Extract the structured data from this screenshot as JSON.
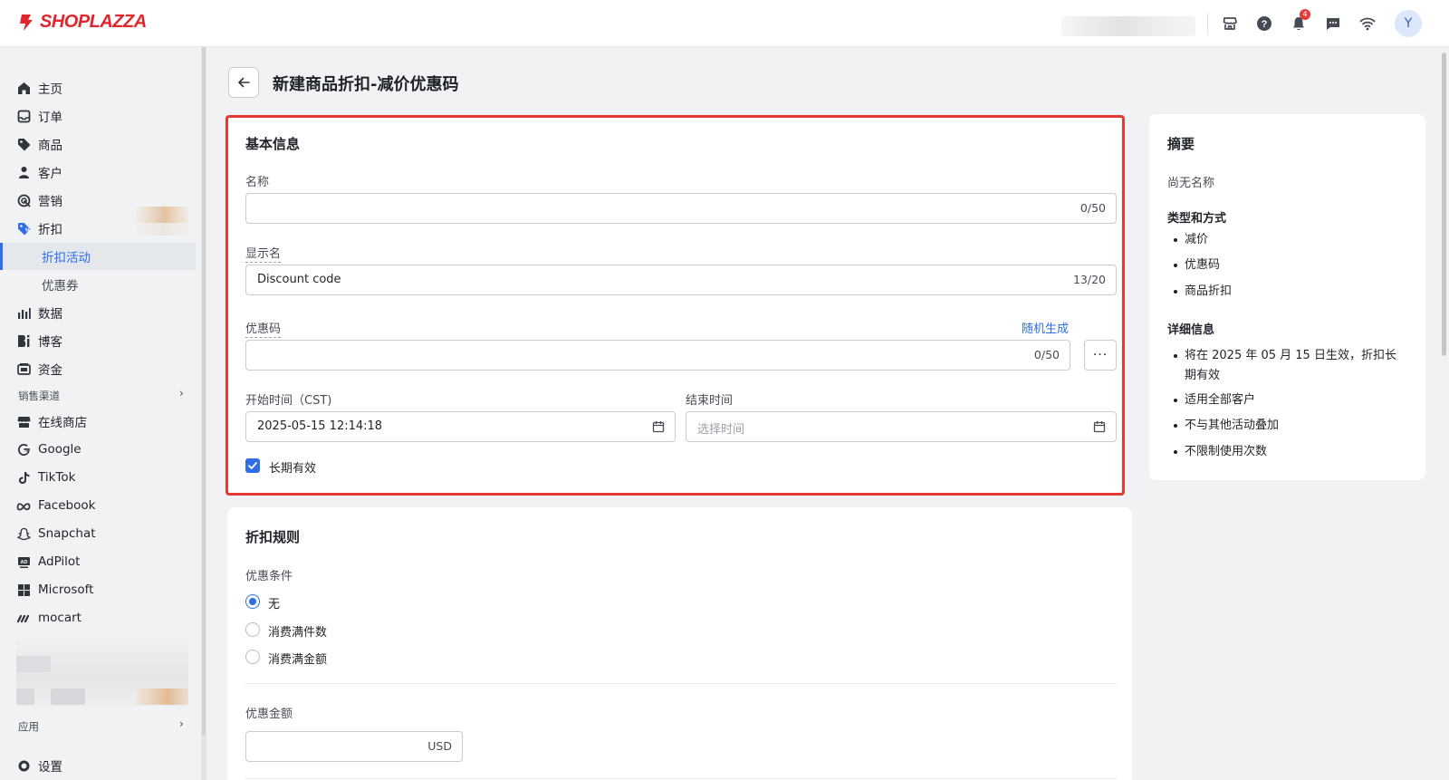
{
  "brand": {
    "name": "SHOPLAZZA",
    "color": "#e0262d"
  },
  "topbar": {
    "icons": [
      "store-icon",
      "help-icon",
      "bell-icon",
      "chat-icon",
      "wifi-icon"
    ],
    "notification_count": "4",
    "avatar_initial": "Y"
  },
  "sidebar": {
    "items": [
      {
        "label": "主页",
        "icon": "home-icon"
      },
      {
        "label": "订单",
        "icon": "inbox-icon"
      },
      {
        "label": "商品",
        "icon": "tag-icon"
      },
      {
        "label": "客户",
        "icon": "person-icon"
      },
      {
        "label": "营销",
        "icon": "target-icon"
      },
      {
        "label": "折扣",
        "icon": "discount-icon"
      },
      {
        "label": "折扣活动",
        "sub": true,
        "active": true
      },
      {
        "label": "优惠券",
        "sub": true
      },
      {
        "label": "数据",
        "icon": "chart-icon"
      },
      {
        "label": "博客",
        "icon": "blog-icon"
      },
      {
        "label": "资金",
        "icon": "wallet-icon"
      }
    ],
    "channels_label": "销售渠道",
    "channels": [
      {
        "label": "在线商店",
        "icon": "store-icon"
      },
      {
        "label": "Google",
        "icon": "google-icon"
      },
      {
        "label": "TikTok",
        "icon": "tiktok-icon"
      },
      {
        "label": "Facebook",
        "icon": "meta-icon"
      },
      {
        "label": "Snapchat",
        "icon": "snapchat-icon"
      },
      {
        "label": "AdPilot",
        "icon": "ad-icon"
      },
      {
        "label": "Microsoft",
        "icon": "microsoft-icon"
      },
      {
        "label": "mocart",
        "icon": "mocart-icon"
      }
    ],
    "apps_label": "应用",
    "settings_label": "设置"
  },
  "page": {
    "title": "新建商品折扣-减价优惠码"
  },
  "basic_info": {
    "title": "基本信息",
    "name_label": "名称",
    "name_value": "",
    "name_count": "0/50",
    "display_label": "显示名",
    "display_value": "Discount code",
    "display_count": "13/20",
    "code_label": "优惠码",
    "code_random_link": "随机生成",
    "code_value": "",
    "code_count": "0/50",
    "more_label": "···",
    "start_label": "开始时间（CST)",
    "start_value": "2025-05-15 12:14:18",
    "end_label": "结束时间",
    "end_placeholder": "选择时间",
    "long_term_label": "长期有效",
    "long_term_checked": true
  },
  "rules": {
    "title": "折扣规则",
    "condition_label": "优惠条件",
    "options": [
      "无",
      "消费满件数",
      "消费满金额"
    ],
    "selected": "无",
    "amount_label": "优惠金额",
    "amount_value": "",
    "currency": "USD"
  },
  "summary": {
    "title": "摘要",
    "no_name": "尚无名称",
    "type_head": "类型和方式",
    "type_items": [
      "减价",
      "优惠码",
      "商品折扣"
    ],
    "detail_head": "详细信息",
    "detail_items": [
      "将在 2025 年 05 月 15 日生效，折扣长期有效",
      "适用全部客户",
      "不与其他活动叠加",
      "不限制使用次数"
    ]
  },
  "colors": {
    "accent": "#2f6ee6",
    "highlight": "#e53935"
  }
}
